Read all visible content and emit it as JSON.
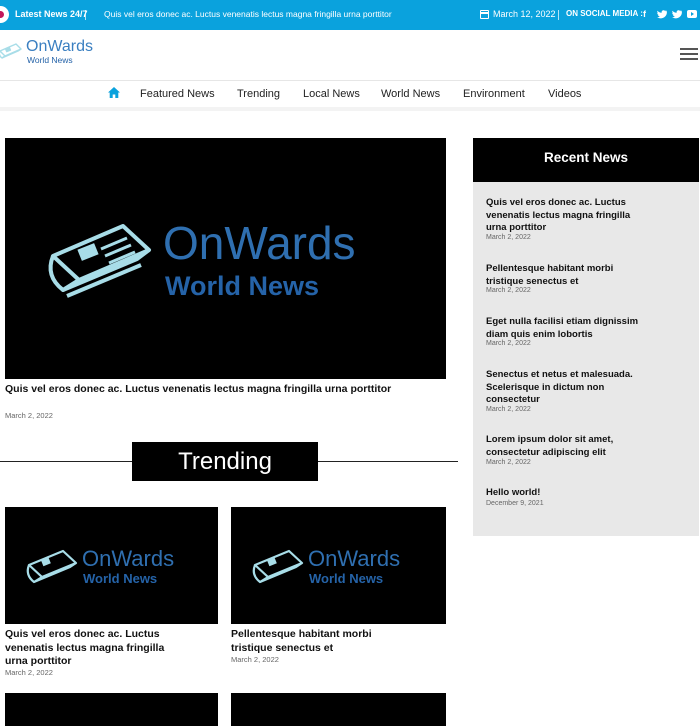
{
  "topbar": {
    "latest_label": "Latest News 24/7",
    "ticker_text": "Quis vel eros donec ac. Luctus venenatis lectus magna fringilla urna porttitor",
    "date": "March 12, 2022",
    "social_label": "ON SOCIAL MEDIA :",
    "social_icons": [
      "facebook-icon",
      "twitter-icon",
      "twitter-icon",
      "youtube-icon"
    ]
  },
  "header": {
    "logo_title": "OnWards",
    "logo_subtitle": "World News"
  },
  "nav": {
    "items": [
      "Featured News",
      "Trending",
      "Local News",
      "World News",
      "Environment",
      "Videos"
    ]
  },
  "hero": {
    "image_title": "OnWards",
    "image_subtitle": "World News",
    "title": "Quis vel eros donec ac. Luctus venenatis lectus magna fringilla urna porttitor",
    "date": "March 2, 2022"
  },
  "trending": {
    "heading": "Trending",
    "cards": [
      {
        "image_title": "OnWards",
        "image_subtitle": "World News",
        "title": "Quis vel eros donec ac. Luctus venenatis lectus magna fringilla urna porttitor",
        "date": "March 2, 2022"
      },
      {
        "image_title": "OnWards",
        "image_subtitle": "World News",
        "title": "Pellentesque habitant morbi tristique senectus et",
        "date": "March 2, 2022"
      }
    ]
  },
  "sidebar": {
    "heading": "Recent News",
    "items": [
      {
        "title": "Quis vel eros donec ac. Luctus venenatis lectus magna fringilla urna porttitor",
        "date": "March 2, 2022"
      },
      {
        "title": "Pellentesque habitant morbi tristique senectus et",
        "date": "March 2, 2022"
      },
      {
        "title": "Eget nulla facilisi etiam dignissim diam quis enim lobortis",
        "date": "March 2, 2022"
      },
      {
        "title": "Senectus et netus et malesuada. Scelerisque in dictum non consectetur",
        "date": "March 2, 2022"
      },
      {
        "title": "Lorem ipsum dolor sit amet, consectetur adipiscing elit",
        "date": "March 2, 2022"
      },
      {
        "title": "Hello world!",
        "date": "December 9, 2021"
      }
    ]
  },
  "colors": {
    "topbar": "#0aa2dd",
    "logo_blue": "#3a7fc1",
    "image_title": "#2f6fb0",
    "image_subtitle": "#2563a8",
    "icon_outline": "#a8dde8"
  }
}
